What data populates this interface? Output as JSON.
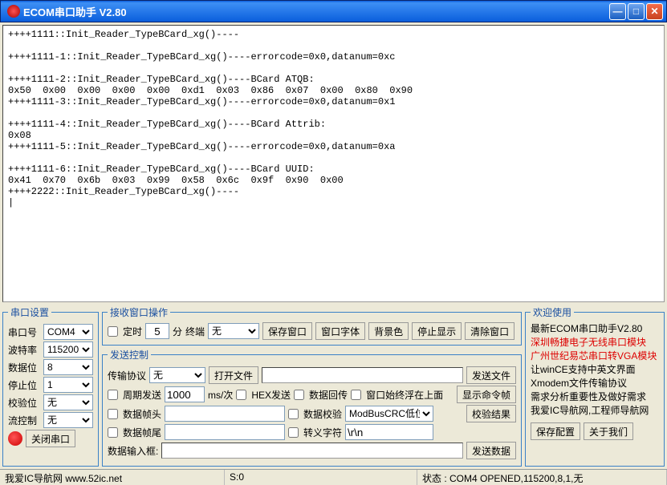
{
  "window": {
    "title": "ECOM串口助手   V2.80"
  },
  "terminal": "++++1111::Init_Reader_TypeBCard_xg()----\n\n++++1111-1::Init_Reader_TypeBCard_xg()----errorcode=0x0,datanum=0xc\n\n++++1111-2::Init_Reader_TypeBCard_xg()----BCard ATQB:\n0x50  0x00  0x00  0x00  0x00  0xd1  0x03  0x86  0x07  0x00  0x80  0x90\n++++1111-3::Init_Reader_TypeBCard_xg()----errorcode=0x0,datanum=0x1\n\n++++1111-4::Init_Reader_TypeBCard_xg()----BCard Attrib:\n0x08\n++++1111-5::Init_Reader_TypeBCard_xg()----errorcode=0x0,datanum=0xa\n\n++++1111-6::Init_Reader_TypeBCard_xg()----BCard UUID:\n0x41  0x70  0x6b  0x03  0x99  0x58  0x6c  0x9f  0x90  0x00\n++++2222::Init_Reader_TypeBCard_xg()----\n|",
  "port": {
    "legend": "串口设置",
    "rows": {
      "port_lbl": "串口号",
      "port_val": "COM4",
      "baud_lbl": "波特率",
      "baud_val": "115200",
      "data_lbl": "数据位",
      "data_val": "8",
      "stop_lbl": "停止位",
      "stop_val": "1",
      "parity_lbl": "校验位",
      "parity_val": "无",
      "flow_lbl": "流控制",
      "flow_val": "无"
    },
    "close_btn": "关闭串口"
  },
  "recv": {
    "legend": "接收窗口操作",
    "timer_lbl": "定时",
    "timer_val": "5",
    "timer_unit": "分",
    "term_lbl": "终端",
    "term_val": "无",
    "btn_save": "保存窗口",
    "btn_font": "窗口字体",
    "btn_bg": "背景色",
    "btn_stop": "停止显示",
    "btn_clear": "清除窗口"
  },
  "send": {
    "legend": "发送控制",
    "proto_lbl": "传输协议",
    "proto_val": "无",
    "btn_open": "打开文件",
    "btn_sendfile": "发送文件",
    "period_lbl": "周期发送",
    "period_val": "1000",
    "period_unit": "ms/次",
    "hex_lbl": "HEX发送",
    "echo_lbl": "数据回传",
    "ontop_lbl": "窗口始终浮在上面",
    "btn_showcmd": "显示命令帧",
    "head_lbl": "数据帧头",
    "check_lbl": "数据校验",
    "check_val": "ModBusCRC低位",
    "btn_checkres": "校验结果",
    "tail_lbl": "数据帧尾",
    "esc_lbl": "转义字符",
    "esc_val": "\\r\\n",
    "input_lbl": "数据输入框:",
    "btn_send": "发送数据"
  },
  "welcome": {
    "legend": "欢迎使用",
    "l1": "最新ECOM串口助手V2.80",
    "l2": "深圳畅捷电子无线串口模块",
    "l3": "广州世纪易芯串口转VGA模块",
    "l4": "让winCE支持中英文界面",
    "l5": "Xmodem文件传输协议",
    "l6": "需求分析重要性及做好需求",
    "l7": "我爱IC导航网,工程师导航网",
    "btn_save": "保存配置",
    "btn_about": "关于我们"
  },
  "status": {
    "s1": "我爱IC导航网  www.52ic.net",
    "s2": "S:0",
    "s3": "状态 : COM4 OPENED,115200,8,1,无"
  }
}
